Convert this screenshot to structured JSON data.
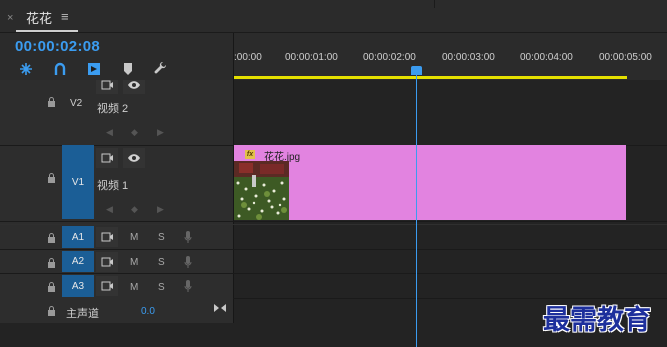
{
  "sequence_tab": {
    "close": "×",
    "title": "花花",
    "menu": "≡"
  },
  "timecode": "00:00:02:08",
  "toolbar": [
    {
      "icon": "snap-icon"
    },
    {
      "icon": "linked-selection-icon"
    },
    {
      "icon": "insert-nest-icon"
    },
    {
      "icon": "add-marker-icon"
    },
    {
      "icon": "wrench-settings-icon"
    }
  ],
  "ruler": {
    "ticks": [
      ":00:00",
      "00:00:01:00",
      "00:00:02:00",
      "00:00:03:00",
      "00:00:04:00",
      "00:00:05:00"
    ]
  },
  "video_tracks": [
    {
      "id": "V2",
      "name": "视频 2"
    },
    {
      "id": "V1",
      "name": "视频 1"
    }
  ],
  "audio_tracks": [
    {
      "id": "A1",
      "mute": "M",
      "solo": "S"
    },
    {
      "id": "A2",
      "mute": "M",
      "solo": "S"
    },
    {
      "id": "A3",
      "mute": "M",
      "solo": "S"
    }
  ],
  "master": {
    "label": "主声道",
    "value": "0.0"
  },
  "clip": {
    "badge": "fx",
    "name": "花花.jpg",
    "color": "#e283e0"
  },
  "playhead_time": "00:00:02:08",
  "watermark": "最需教育",
  "colors": {
    "accent": "#3b9cf0",
    "work_area": "#e5e000",
    "track_target": "#1b5e96"
  }
}
